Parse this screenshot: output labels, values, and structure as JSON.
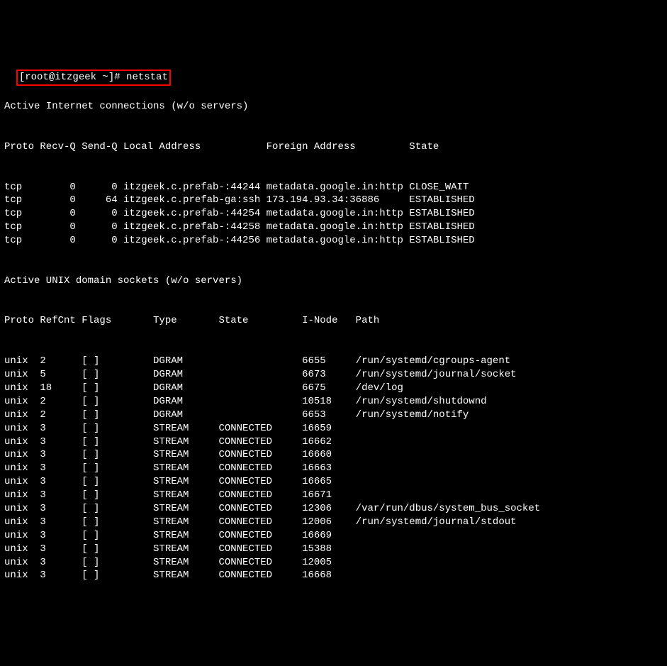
{
  "prompt": "[root@itzgeek ~]# netstat",
  "header1": "Active Internet connections (w/o servers)",
  "inetCols": "Proto Recv-Q Send-Q Local Address           Foreign Address         State",
  "inetRows": [
    "tcp        0      0 itzgeek.c.prefab-:44244 metadata.google.in:http CLOSE_WAIT",
    "tcp        0     64 itzgeek.c.prefab-ga:ssh 173.194.93.34:36886     ESTABLISHED",
    "tcp        0      0 itzgeek.c.prefab-:44254 metadata.google.in:http ESTABLISHED",
    "tcp        0      0 itzgeek.c.prefab-:44258 metadata.google.in:http ESTABLISHED",
    "tcp        0      0 itzgeek.c.prefab-:44256 metadata.google.in:http ESTABLISHED"
  ],
  "header2": "Active UNIX domain sockets (w/o servers)",
  "unixCols": "Proto RefCnt Flags       Type       State         I-Node   Path",
  "unixRows": [
    "unix  2      [ ]         DGRAM                    6655     /run/systemd/cgroups-agent",
    "unix  5      [ ]         DGRAM                    6673     /run/systemd/journal/socket",
    "unix  18     [ ]         DGRAM                    6675     /dev/log",
    "unix  2      [ ]         DGRAM                    10518    /run/systemd/shutdownd",
    "unix  2      [ ]         DGRAM                    6653     /run/systemd/notify",
    "unix  3      [ ]         STREAM     CONNECTED     16659",
    "unix  3      [ ]         STREAM     CONNECTED     16662",
    "unix  3      [ ]         STREAM     CONNECTED     16660",
    "unix  3      [ ]         STREAM     CONNECTED     16663",
    "unix  3      [ ]         STREAM     CONNECTED     16665",
    "unix  3      [ ]         STREAM     CONNECTED     16671",
    "unix  3      [ ]         STREAM     CONNECTED     12306    /var/run/dbus/system_bus_socket",
    "unix  3      [ ]         STREAM     CONNECTED     12006    /run/systemd/journal/stdout",
    "unix  3      [ ]         STREAM     CONNECTED     16669",
    "unix  3      [ ]         STREAM     CONNECTED     15388",
    "unix  3      [ ]         STREAM     CONNECTED     12005",
    "unix  3      [ ]         STREAM     CONNECTED     16668"
  ]
}
